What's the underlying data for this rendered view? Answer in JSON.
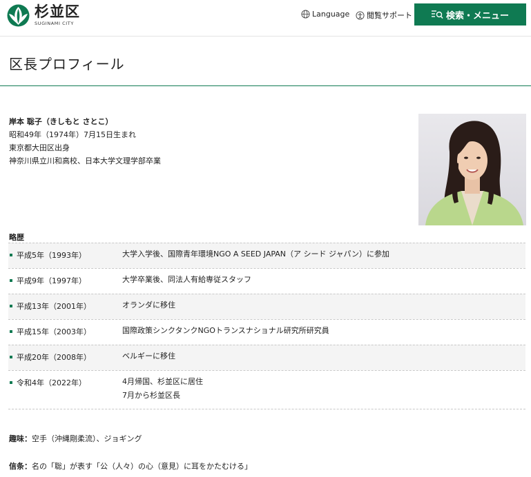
{
  "header": {
    "logo_ja": "杉並区",
    "logo_en": "SUGINAMI CITY",
    "language_label": "Language",
    "accessibility_label": "閲覧サポート",
    "search_label": "検索・メニュー"
  },
  "page": {
    "title": "区長プロフィール"
  },
  "profile": {
    "name": "岸本 聡子（きしもと さとこ）",
    "birth": "昭和49年（1974年）7月15日生まれ",
    "origin": "東京都大田区出身",
    "education": "神奈川県立川和高校、日本大学文理学部卒業"
  },
  "career": {
    "heading": "略歴",
    "items": [
      {
        "date": "平成5年（1993年）",
        "lines": [
          "大学入学後、国際青年環境NGO A SEED JAPAN（ア シード ジャパン）に参加"
        ]
      },
      {
        "date": "平成9年（1997年）",
        "lines": [
          "大学卒業後、同法人有給専従スタッフ"
        ]
      },
      {
        "date": "平成13年（2001年）",
        "lines": [
          "オランダに移住"
        ]
      },
      {
        "date": "平成15年（2003年）",
        "lines": [
          "国際政策シンクタンクNGOトランスナショナル研究所研究員"
        ]
      },
      {
        "date": "平成20年（2008年）",
        "lines": [
          "ベルギーに移住"
        ]
      },
      {
        "date": "令和4年（2022年）",
        "lines": [
          "4月帰国、杉並区に居住",
          "7月から杉並区長"
        ]
      }
    ]
  },
  "hobby": {
    "label": "趣味：",
    "text": "空手（沖縄剛柔流）、ジョギング"
  },
  "motto": {
    "label": "信条：",
    "text": "名の「聡」が表す「公（人々）の心（意見）に耳をかたむける」"
  },
  "colors": {
    "brand_green": "#0f7a52",
    "row_shade": "#f4f4f4"
  }
}
